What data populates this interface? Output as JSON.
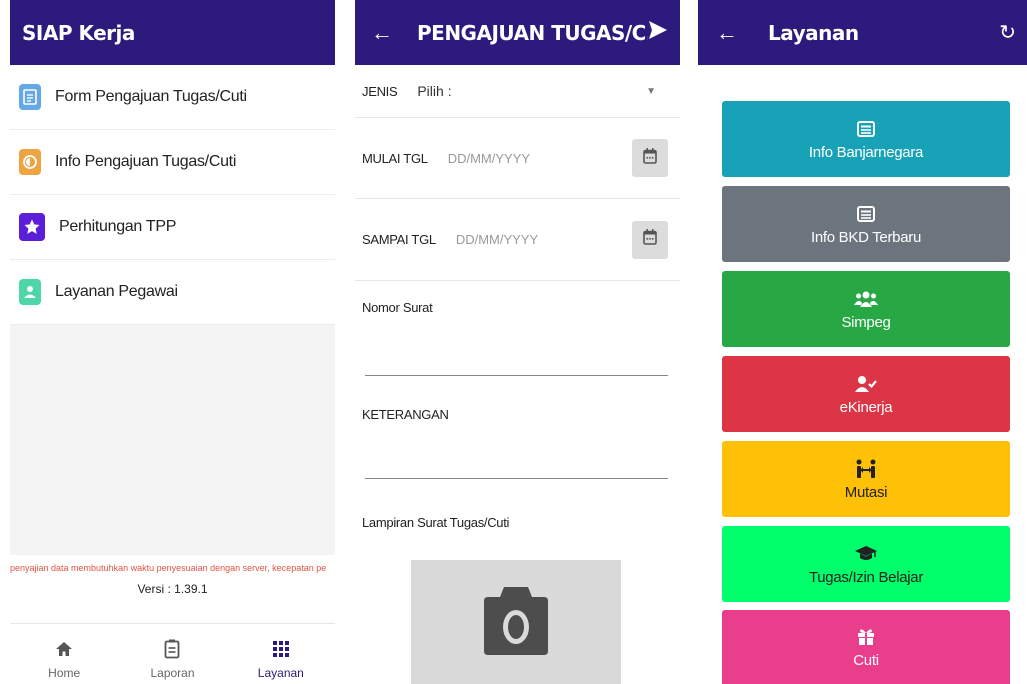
{
  "screen1": {
    "title": "SIAP Kerja",
    "menu": [
      {
        "label": "Form Pengajuan Tugas/Cuti",
        "icon": "form-edit-icon",
        "color": "#64a8e8"
      },
      {
        "label": "Info Pengajuan Tugas/Cuti",
        "icon": "info-clock-icon",
        "color": "#eda441"
      },
      {
        "label": "Perhitungan TPP",
        "icon": "star-icon",
        "color": "#5b1fd9"
      },
      {
        "label": "Layanan Pegawai",
        "icon": "person-icon",
        "color": "#4ed6a6"
      }
    ],
    "note": "penyajian data membutuhkan waktu penyesuaian dengan server, kecepatan pe",
    "version": "Versi : 1.39.1",
    "nav": [
      {
        "label": "Home",
        "icon": "home-icon"
      },
      {
        "label": "Laporan",
        "icon": "report-icon"
      },
      {
        "label": "Layanan",
        "icon": "grid-icon"
      }
    ]
  },
  "screen2": {
    "title": "PENGAJUAN TUGAS/C...",
    "jenis_label": "JENIS",
    "jenis_value": "Pilih :",
    "mulai_label": "MULAI TGL",
    "mulai_placeholder": "DD/MM/YYYY",
    "sampai_label": "SAMPAI TGL",
    "sampai_placeholder": "DD/MM/YYYY",
    "nomor_label": "Nomor Surat",
    "keterangan_label": "KETERANGAN",
    "lampiran_label": "Lampiran Surat Tugas/Cuti"
  },
  "screen3": {
    "title": "Layanan",
    "tiles": [
      {
        "label": "Info Banjarnegara",
        "icon": "news-icon",
        "color": "#17a2b8"
      },
      {
        "label": "Info BKD Terbaru",
        "icon": "news-icon",
        "color": "#6c757d"
      },
      {
        "label": "Simpeg",
        "icon": "users-icon",
        "color": "#28a745"
      },
      {
        "label": "eKinerja",
        "icon": "user-check-icon",
        "color": "#dc3545"
      },
      {
        "label": "Mutasi",
        "icon": "people-arrows-icon",
        "color": "#ffc107"
      },
      {
        "label": "Tugas/Izin Belajar",
        "icon": "graduation-cap-icon",
        "color": "#00ff6a"
      },
      {
        "label": "Cuti",
        "icon": "gift-icon",
        "color": "#e83e8c"
      }
    ]
  },
  "colors": {
    "appbar": "#2c1a7c"
  }
}
